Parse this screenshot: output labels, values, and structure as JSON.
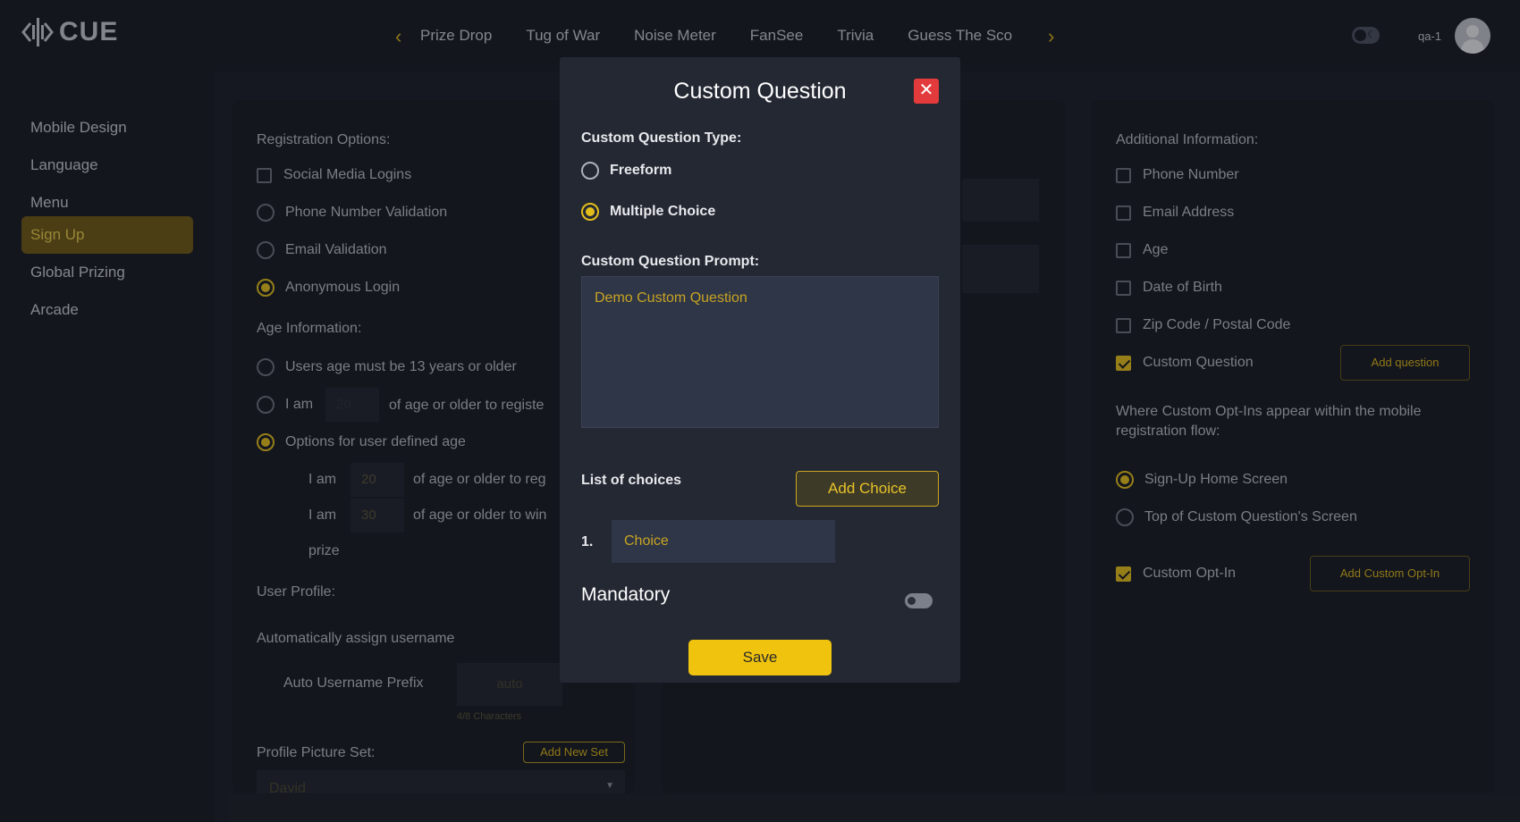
{
  "header": {
    "logo_text": "CUE",
    "games": [
      "Prize Drop",
      "Tug of War",
      "Noise Meter",
      "FanSee",
      "Trivia",
      "Guess The Sco"
    ],
    "user_name": "qa-1"
  },
  "sidebar": {
    "items": [
      {
        "label": "Mobile Design",
        "active": false
      },
      {
        "label": "Language",
        "active": false
      },
      {
        "label": "Menu",
        "active": false
      },
      {
        "label": "Sign Up",
        "active": true
      },
      {
        "label": "Global Prizing",
        "active": false
      },
      {
        "label": "Arcade",
        "active": false
      }
    ]
  },
  "left_panel": {
    "registration_title": "Registration Options:",
    "registration_options": [
      {
        "label": "Social Media Logins",
        "type": "checkbox",
        "checked": false
      },
      {
        "label": "Phone Number Validation",
        "type": "radio",
        "checked": false
      },
      {
        "label": "Email Validation",
        "type": "radio",
        "checked": false
      },
      {
        "label": "Anonymous Login",
        "type": "radio",
        "checked": true
      }
    ],
    "age_title": "Age Information:",
    "age_option_13": "Users age must be 13 years or older",
    "age_option_iam": "I am",
    "age_option_iam_value": "20",
    "age_option_iam_suffix": "of age or older to registe",
    "age_option_user_defined": "Options for user defined age",
    "age_row1_prefix": "I am",
    "age_row1_value": "20",
    "age_row1_suffix": "of age or older to reg",
    "age_row2_prefix": "I am",
    "age_row2_value": "30",
    "age_row2_suffix": "of age or older to win",
    "age_row2_tail": "prize",
    "user_profile_title": "User Profile:",
    "auto_assign": "Automatically assign username",
    "prefix_label": "Auto Username Prefix",
    "prefix_value": "auto",
    "prefix_count": "4/8 Characters",
    "picture_set_label": "Profile Picture Set:",
    "add_new_set": "Add New Set",
    "picture_set_value": "David"
  },
  "right_panel": {
    "title": "Additional Information:",
    "options": [
      {
        "label": "Phone Number",
        "checked": false
      },
      {
        "label": "Email Address",
        "checked": false
      },
      {
        "label": "Age",
        "checked": false
      },
      {
        "label": "Date of Birth",
        "checked": false
      },
      {
        "label": "Zip Code / Postal Code",
        "checked": false
      },
      {
        "label": "Custom Question",
        "checked": true
      }
    ],
    "add_question": "Add question",
    "optin_location_title": "Where Custom Opt-Ins appear within the mobile registration flow:",
    "optin_locations": [
      {
        "label": "Sign-Up Home Screen",
        "checked": true
      },
      {
        "label": "Top of Custom Question's Screen",
        "checked": false
      }
    ],
    "custom_optin": "Custom Opt-In",
    "custom_optin_checked": true,
    "add_custom_optin": "Add Custom Opt-In"
  },
  "modal": {
    "title": "Custom Question",
    "close_symbol": "✕",
    "type_label": "Custom Question Type:",
    "types": [
      {
        "label": "Freeform",
        "selected": false
      },
      {
        "label": "Multiple Choice",
        "selected": true
      }
    ],
    "prompt_label": "Custom Question Prompt:",
    "prompt_value": "Demo Custom Question",
    "choices_label": "List of choices",
    "add_choice": "Add Choice",
    "choice_number": "1.",
    "choice_placeholder": "Choice",
    "mandatory_label": "Mandatory",
    "mandatory_on": false,
    "save": "Save"
  },
  "colors": {
    "accent": "#e2be1c",
    "background": "#191c24",
    "active_nav": "#6f5a17",
    "close_red": "#e33b3b"
  }
}
